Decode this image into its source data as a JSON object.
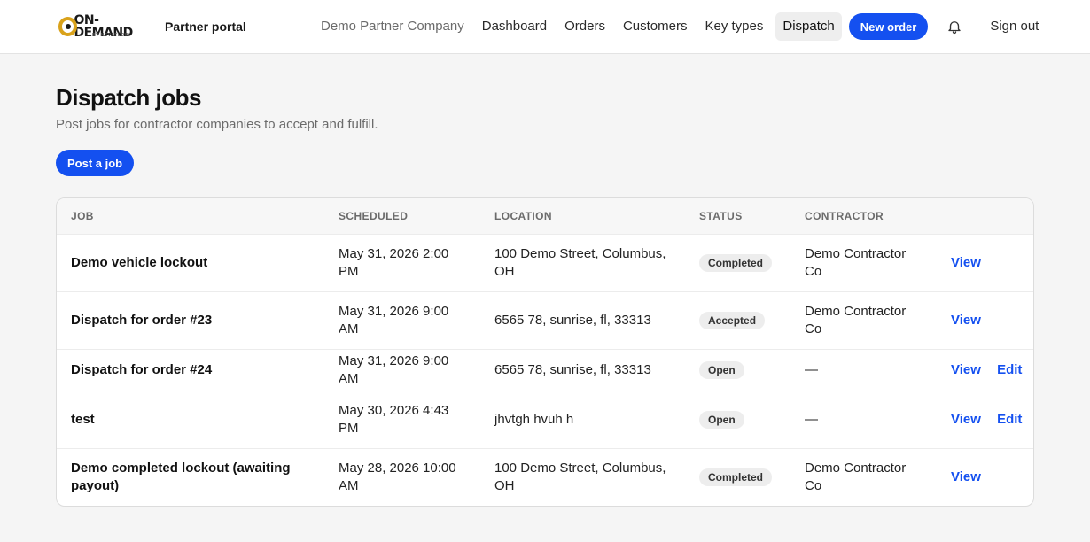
{
  "header": {
    "logo_text": "ON-DEMAND",
    "logo_sub": "BY NEVAFLOW",
    "portal_label": "Partner portal",
    "company": "Demo Partner Company",
    "nav": [
      "Dashboard",
      "Orders",
      "Customers",
      "Key types",
      "Dispatch"
    ],
    "active_nav": "Dispatch",
    "new_order_label": "New order",
    "sign_out_label": "Sign out"
  },
  "page": {
    "title": "Dispatch jobs",
    "subtitle": "Post jobs for contractor companies to accept and fulfill.",
    "post_job_label": "Post a job"
  },
  "table": {
    "columns": [
      "JOB",
      "SCHEDULED",
      "LOCATION",
      "STATUS",
      "CONTRACTOR",
      ""
    ],
    "rows": [
      {
        "job": "Demo vehicle lockout",
        "scheduled": "May 31, 2026 2:00 PM",
        "location": "100 Demo Street, Columbus, OH",
        "status": "Completed",
        "contractor": "Demo Contractor Co",
        "view": "View",
        "edit": ""
      },
      {
        "job": "Dispatch for order #23",
        "scheduled": "May 31, 2026 9:00 AM",
        "location": "6565 78, sunrise, fl, 33313",
        "status": "Accepted",
        "contractor": "Demo Contractor Co",
        "view": "View",
        "edit": ""
      },
      {
        "job": "Dispatch for order #24",
        "scheduled": "May 31, 2026 9:00 AM",
        "location": "6565 78, sunrise, fl, 33313",
        "status": "Open",
        "contractor": "—",
        "view": "View",
        "edit": "Edit"
      },
      {
        "job": "test",
        "scheduled": "May 30, 2026 4:43 PM",
        "location": "jhvtgh hvuh h",
        "status": "Open",
        "contractor": "—",
        "view": "View",
        "edit": "Edit"
      },
      {
        "job": "Demo completed lockout (awaiting payout)",
        "scheduled": "May 28, 2026 10:00 AM",
        "location": "100 Demo Street, Columbus, OH",
        "status": "Completed",
        "contractor": "Demo Contractor Co",
        "view": "View",
        "edit": ""
      }
    ]
  },
  "colors": {
    "accent": "#1450f0",
    "logo_gold": "#d9a21b",
    "page_bg": "#f5f5f5"
  },
  "icons": {
    "bell": "bell-icon",
    "logo": "logo-ring-icon"
  }
}
